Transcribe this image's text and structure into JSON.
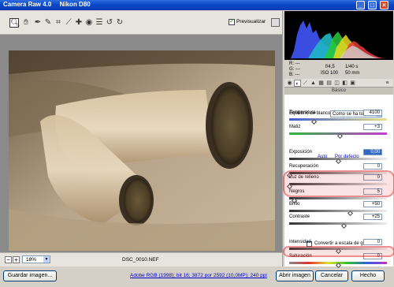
{
  "window": {
    "title": "Camera Raw 4.0",
    "camera": "Nikon D80"
  },
  "toolbar": {
    "tools": [
      "zoom-icon",
      "hand-icon",
      "white-balance-icon",
      "color-sampler-icon",
      "crop-icon",
      "straighten-icon",
      "retouch-icon",
      "red-eye-icon",
      "preferences-icon",
      "rotate-ccw-icon",
      "rotate-cw-icon"
    ],
    "preview_label": "Previsualizar",
    "preview_checked": true
  },
  "bottom": {
    "zoom": "18%",
    "filename": "DSC_0010.NEF"
  },
  "footer": {
    "save_label": "Guardar imagen...",
    "workflow_link": "Adobe RGB (1998); bit 16; 3872 por 2592 (10,0MP); 240 ppi",
    "open_label": "Abrir imagen",
    "cancel_label": "Cancelar",
    "done_label": "Hecho"
  },
  "readout": {
    "r": "R:  ---",
    "g": "G:  ---",
    "b": "B:  ---",
    "aperture": "f/4,5",
    "shutter": "1/40 s",
    "iso": "ISO 100",
    "focal": "50 mm"
  },
  "panel": {
    "title": "Básico",
    "wb_label": "Equilibrio de blancos:",
    "wb_value": "Como se ha tomado",
    "auto_link": "Auto",
    "default_link": "Por defecto",
    "grayscale_label": "Convertir a escala de grises",
    "sliders": [
      {
        "label": "Temperatura",
        "value": "4100",
        "pos": 0.25,
        "kind": "temp"
      },
      {
        "label": "Matiz",
        "value": "+3",
        "pos": 0.52,
        "kind": "tint"
      },
      {
        "label": "Exposición",
        "value": "0,00",
        "pos": 0.5,
        "kind": "gray",
        "selected": true
      },
      {
        "label": "Recuperación",
        "value": "0",
        "pos": 0.0,
        "kind": "gray"
      },
      {
        "label": "Luz de relleno",
        "value": "0",
        "pos": 0.0,
        "kind": "gray"
      },
      {
        "label": "Negros",
        "value": "5",
        "pos": 0.05,
        "kind": "gray"
      },
      {
        "label": "Brillo",
        "value": "+50",
        "pos": 0.62,
        "kind": "gray"
      },
      {
        "label": "Contraste",
        "value": "+25",
        "pos": 0.56,
        "kind": "gray"
      },
      {
        "label": "Intensidad",
        "value": "0",
        "pos": 0.5,
        "kind": "gray"
      },
      {
        "label": "Saturación",
        "value": "0",
        "pos": 0.5,
        "kind": "sat"
      }
    ]
  },
  "colors": {
    "title_blue": "#0a47c8",
    "highlight": "#dc2828",
    "link": "#0000cc"
  }
}
